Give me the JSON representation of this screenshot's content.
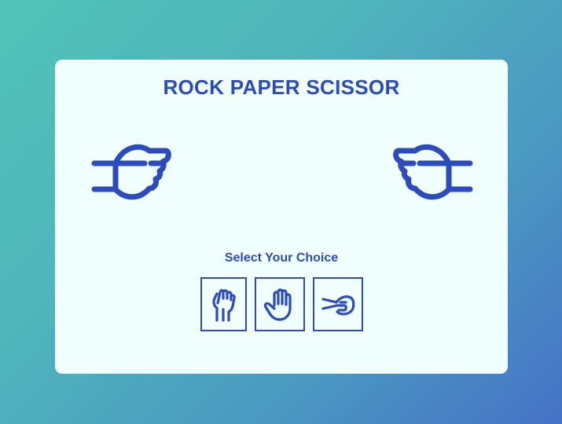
{
  "game": {
    "title": "ROCK PAPER SCISSOR",
    "choice_prompt": "Select Your Choice"
  },
  "hands": {
    "player": {
      "icon": "scissors-hand-icon"
    },
    "computer": {
      "icon": "scissors-hand-icon"
    }
  },
  "choices": [
    {
      "id": "rock",
      "icon": "rock-hand-icon"
    },
    {
      "id": "paper",
      "icon": "paper-hand-icon"
    },
    {
      "id": "scissor",
      "icon": "scissors-hand-icon"
    }
  ],
  "colors": {
    "accent": "#2b4bbf",
    "card_background": "#f0fffe",
    "background_start": "#52c3b8",
    "background_end": "#4672c6"
  }
}
